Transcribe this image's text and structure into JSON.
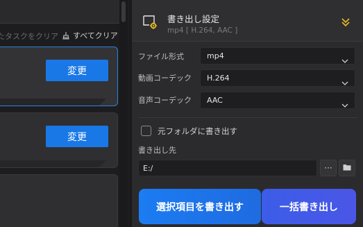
{
  "left": {
    "clear_done_label": "たタスクをクリア",
    "clear_all_label": "すべてクリア",
    "cards": [
      {
        "button_label": "変更"
      },
      {
        "button_label": "変更"
      }
    ]
  },
  "output": {
    "title": "書き出し設定",
    "summary": "mp4 [ H.264, AAC ]",
    "rows": [
      {
        "label": "ファイル形式",
        "value": "mp4"
      },
      {
        "label": "動画コーデック",
        "value": "H.264"
      },
      {
        "label": "音声コーデック",
        "value": "AAC"
      }
    ],
    "save_to_source_label": "元フォルダに書き出す",
    "save_to_source_checked": false,
    "destination_label": "書き出し先",
    "destination_path": "E:/",
    "more_button_label": "···",
    "export_selected_label": "選択項目を書き出す",
    "export_all_label": "一括書き出し"
  },
  "colors": {
    "accent": "#1a78e6",
    "gold": "#e0b422",
    "selected_border": "#2f7fe0"
  }
}
